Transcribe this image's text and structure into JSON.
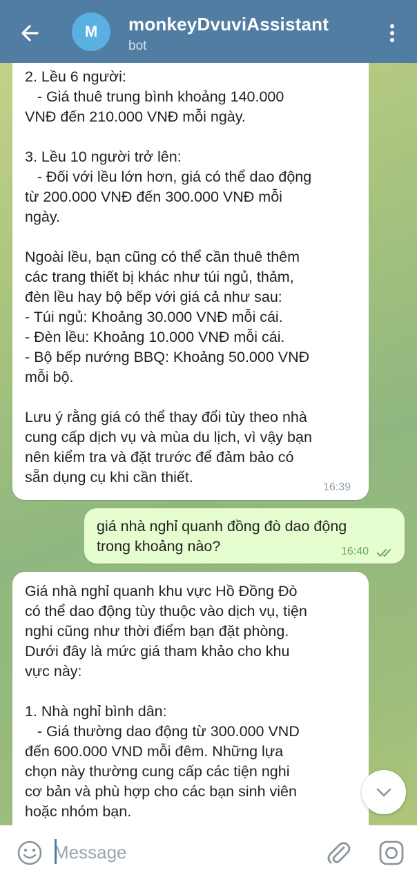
{
  "header": {
    "title": "monkeyDvuviAssistant",
    "subtitle": "bot",
    "avatar_letter": "M",
    "back_icon": "arrow-left-icon",
    "menu_icon": "more-vertical-icon"
  },
  "messages": [
    {
      "direction": "in",
      "lines": [
        "2. Lều 6 người:",
        "   - Giá thuê trung bình khoảng 140.000",
        "VNĐ đến 210.000 VNĐ mỗi ngày.",
        "",
        "3. Lều 10 người trở lên:",
        "   - Đối với lều lớn hơn, giá có thể dao động",
        "từ 200.000 VNĐ đến 300.000 VNĐ mỗi",
        "ngày.",
        "",
        "Ngoài lều, bạn cũng có thể cần thuê thêm",
        "các trang thiết bị khác như túi ngủ, thảm,",
        "đèn lều hay bộ bếp với giá cả như sau:",
        "- Túi ngủ: Khoảng 30.000 VNĐ mỗi cái.",
        "- Đèn lều: Khoảng 10.000 VNĐ mỗi cái.",
        "- Bộ bếp nướng BBQ: Khoảng 50.000 VNĐ",
        "mỗi bộ.",
        "",
        "Lưu ý rằng giá có thể thay đổi tùy theo nhà",
        "cung cấp dịch vụ và mùa du lịch, vì vậy bạn",
        "nên kiểm tra và đặt trước để đảm bảo có",
        "sẵn dụng cụ khi cần thiết."
      ],
      "time": "16:39"
    },
    {
      "direction": "out",
      "lines": [
        "giá nhà nghỉ quanh đồng đò dao động",
        "trong khoảng nào?"
      ],
      "time": "16:40",
      "status_icon": "double-check-icon"
    },
    {
      "direction": "in",
      "lines": [
        "Giá nhà nghỉ quanh khu vực Hồ Đồng Đò",
        "có thể dao động tùy thuộc vào dịch vụ, tiện",
        "nghi cũng như thời điểm bạn đặt phòng.",
        "Dưới đây là mức giá tham khảo cho khu",
        "vực này:",
        "",
        "1. Nhà nghỉ bình dân:",
        "   - Giá thường dao động từ 300.000 VND",
        "đến 600.000 VND mỗi đêm. Những lựa",
        "chọn này thường cung cấp các tiện nghi",
        "cơ bản và phù hợp cho các bạn sinh viên",
        "hoặc nhóm bạn."
      ]
    }
  ],
  "input": {
    "placeholder": "Message",
    "value": ""
  },
  "icons": {
    "emoji": "emoji-icon",
    "attach": "paperclip-icon",
    "camera": "camera-icon",
    "scroll": "chevron-down-icon"
  },
  "colors": {
    "header_bg": "#517da2",
    "incoming_bubble": "#ffffff",
    "outgoing_bubble": "#e6fdcf",
    "check_color": "#6aa75a"
  }
}
